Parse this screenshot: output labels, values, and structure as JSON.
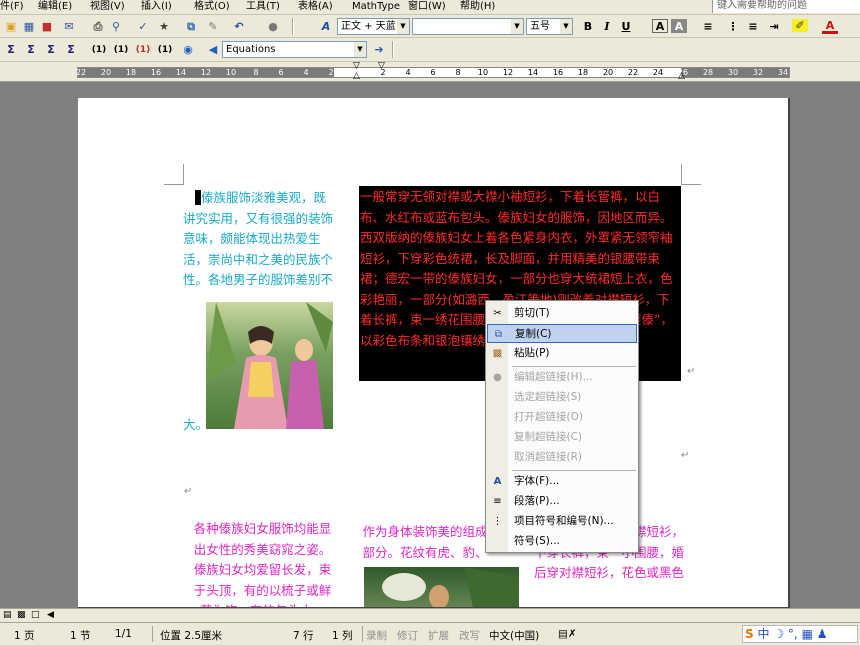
{
  "menu": [
    "件(F)",
    "编辑(E)",
    "视图(V)",
    "插入(I)",
    "格式(O)",
    "工具(T)",
    "表格(A)",
    "MathType",
    "窗口(W)",
    "帮助(H)"
  ],
  "help_search": "键入需要帮助的问题",
  "toolbar": {
    "style": "正文 + 天蓝",
    "font": "",
    "size": "五号",
    "bold": "B",
    "italic": "I",
    "underline": "U"
  },
  "mathtype_bar": {
    "buttons": [
      "Σ",
      "Σ",
      "Σ",
      "Σ",
      "(1)",
      "(1)",
      "(1)",
      "(1)"
    ],
    "tab_name": "Equations"
  },
  "ruler": {
    "left_labels": [
      "22",
      "20",
      "18",
      "16",
      "14",
      "12",
      "10",
      "8",
      "6",
      "4",
      "2"
    ],
    "right_labels": [
      "2",
      "4",
      "6",
      "8",
      "10",
      "12",
      "14",
      "16",
      "18",
      "20",
      "22",
      "24",
      "26",
      "28",
      "30",
      "32",
      "34"
    ]
  },
  "document": {
    "p1": "傣族服饰淡雅美观，既讲究实用，又有很强的装饰意味，颇能体现出热爱生活，崇尚中和之美的民族个性。各地男子的服饰差别不",
    "p1_end": "大。",
    "p2": "一般常穿无领对襟或大襟小袖短衫，下着长管裤，以白布、水红布或蓝布包头。傣族妇女的服饰，因地区而异。西双版纳的傣族妇女上着各色紧身内衣，外罩紧无领窄袖短衫，下穿彩色统裙，长及脚面，并用精美的银腰带束裙；德宏一带的傣族妇女，一部分也穿大统裙短上衣，色彩艳丽，一部分(如潞西、盈江等地)则改着对襟短衫，下着长裤，束一绣花围腰；而新平、元江一带的“花腰傣”，以彩色布条和银泡镶绣，显得光彩耀目。",
    "p3": "各种傣族妇女服饰均能显出女性的秀美窈窕之姿。傣族妇女均爱留长发，束于头顶，有的以梳子或鲜花为饰，有的包头巾。",
    "p4": "作为身体装饰美的组成部分。花纹有虎、豹、",
    "p5": "，婚前多穿花色大襟短衫，下穿长裤，束一小围腰，婚后穿对襟短衫，花色或黑色"
  },
  "context_menu": {
    "items": [
      {
        "label": "剪切(T)",
        "icon": "scissors-icon",
        "disabled": false,
        "highlight": false
      },
      {
        "label": "复制(C)",
        "icon": "copy-icon",
        "disabled": false,
        "highlight": true
      },
      {
        "label": "粘贴(P)",
        "icon": "paste-icon",
        "disabled": false,
        "highlight": false
      },
      {
        "label": "编辑超链接(H)...",
        "icon": "hyperlink-icon",
        "disabled": true,
        "highlight": false
      },
      {
        "label": "选定超链接(S)",
        "icon": "",
        "disabled": true,
        "highlight": false
      },
      {
        "label": "打开超链接(O)",
        "icon": "",
        "disabled": true,
        "highlight": false
      },
      {
        "label": "复制超链接(C)",
        "icon": "",
        "disabled": true,
        "highlight": false
      },
      {
        "label": "取消超链接(R)",
        "icon": "",
        "disabled": true,
        "highlight": false
      },
      {
        "label": "字体(F)...",
        "icon": "font-icon",
        "disabled": false,
        "highlight": false
      },
      {
        "label": "段落(P)...",
        "icon": "paragraph-icon",
        "disabled": false,
        "highlight": false
      },
      {
        "label": "项目符号和编号(N)...",
        "icon": "bullets-icon",
        "disabled": false,
        "highlight": false
      },
      {
        "label": "符号(S)...",
        "icon": "",
        "disabled": false,
        "highlight": false
      }
    ]
  },
  "status": {
    "page": "1 页",
    "section": "1 节",
    "pages": "1/1",
    "position": "位置 2.5厘米",
    "line": "7 行",
    "column": "1 列",
    "rec": "录制",
    "trk": "修订",
    "ext": "扩展",
    "ovr": "改写",
    "lang": "中文(中国)",
    "ime": "中"
  },
  "colors": {
    "p1": "#19aacc",
    "p2_text": "#ff2a2a",
    "p2_bg": "#000000",
    "p3": "#e026c8",
    "menu_highlight": "#c1d2ee"
  }
}
